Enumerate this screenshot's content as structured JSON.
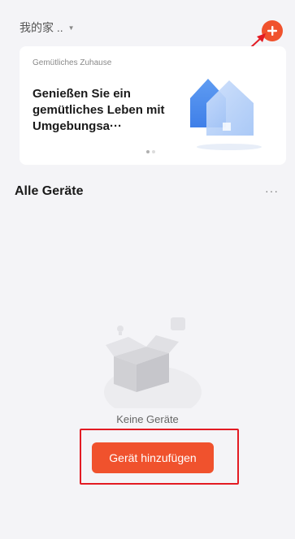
{
  "header": {
    "home_name": "我的家 ..",
    "home_caret_icon": "caret-down-icon",
    "add_icon": "plus-circle-icon",
    "accent_color": "#f0522d"
  },
  "banner": {
    "subtitle": "Gemütliches Zuhause",
    "title": "Genießen Sie ein gemütliches Leben mit Umgebungsa···",
    "illustration_icon": "house-icon",
    "pages": 2,
    "active_page": 1
  },
  "devices_section": {
    "title": "Alle Geräte",
    "more_label": "···"
  },
  "empty_state": {
    "illustration_icon": "empty-box-icon",
    "message": "Keine Geräte",
    "add_button_label": "Gerät hinzufügen"
  },
  "annotations": {
    "color": "#e31b23"
  }
}
